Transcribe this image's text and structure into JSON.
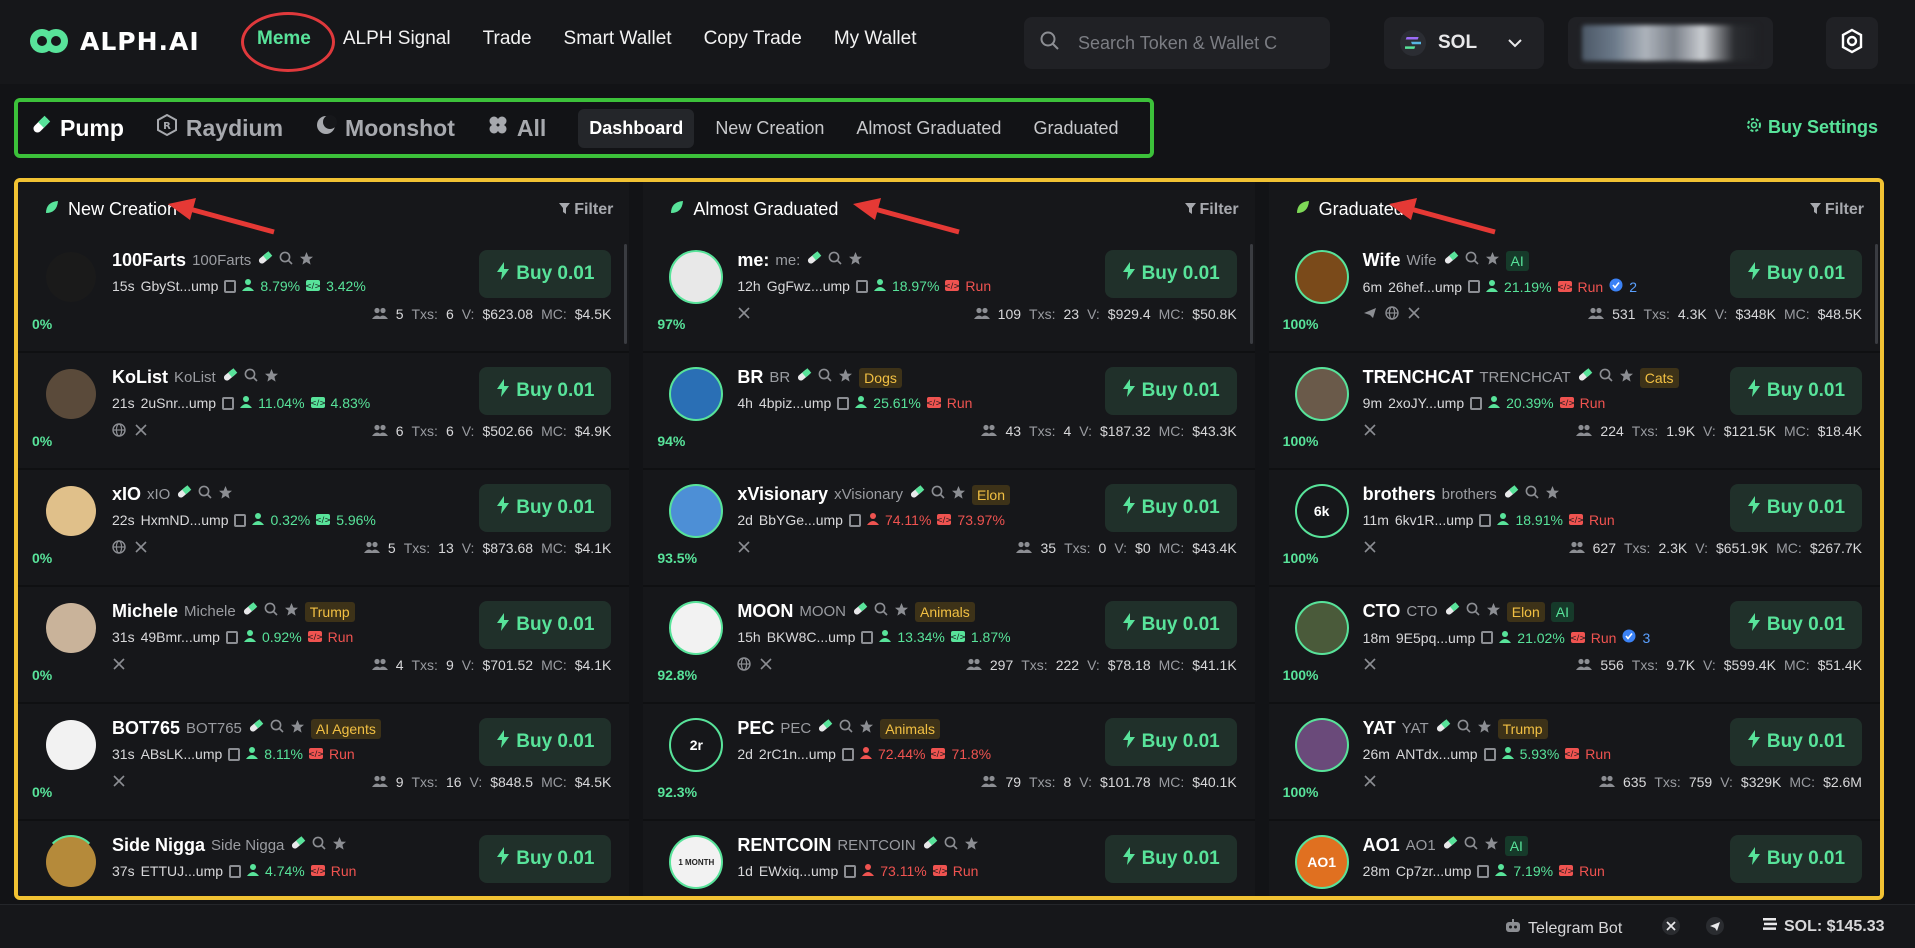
{
  "brand": {
    "name": "ALPH.AI"
  },
  "nav": [
    "Meme",
    "ALPH Signal",
    "Trade",
    "Smart Wallet",
    "Copy Trade",
    "My Wallet"
  ],
  "search": {
    "placeholder": "Search Token & Wallet C"
  },
  "chain": {
    "label": "SOL"
  },
  "platforms": [
    "Pump",
    "Raydium",
    "Moonshot",
    "All"
  ],
  "views": [
    "Dashboard",
    "New Creation",
    "Almost Graduated",
    "Graduated"
  ],
  "buy_settings": "Buy Settings",
  "filter_label": "Filter",
  "buy_label": "Buy 0.01",
  "columns": [
    {
      "title": "New Creation",
      "rows": [
        {
          "name": "100Farts",
          "sym": "100Farts",
          "tag": "",
          "time": "15s",
          "addr": "GbySt...ump",
          "p1": "8.79%",
          "p1c": "green",
          "p2": "3.42%",
          "p2c": "green",
          "run": false,
          "pct": "0%",
          "holders": "5",
          "txs": "6",
          "vol": "$623.08",
          "mc": "$4.5K",
          "social": [],
          "avcolor": "#1a1a1a",
          "ring": "none"
        },
        {
          "name": "KoList",
          "sym": "KoList",
          "tag": "",
          "time": "21s",
          "addr": "2uSnr...ump",
          "p1": "11.04%",
          "p1c": "green",
          "p2": "4.83%",
          "p2c": "green",
          "run": false,
          "pct": "0%",
          "holders": "6",
          "txs": "6",
          "vol": "$502.66",
          "mc": "$4.9K",
          "social": [
            "web",
            "x"
          ],
          "avcolor": "#5a4a3a",
          "ring": "none"
        },
        {
          "name": "xIO",
          "sym": "xIO",
          "tag": "",
          "time": "22s",
          "addr": "HxmND...ump",
          "p1": "0.32%",
          "p1c": "green",
          "p2": "5.96%",
          "p2c": "green",
          "run": false,
          "pct": "0%",
          "holders": "5",
          "txs": "13",
          "vol": "$873.68",
          "mc": "$4.1K",
          "social": [
            "web",
            "x"
          ],
          "avcolor": "#e0c08a",
          "ring": "none"
        },
        {
          "name": "Michele",
          "sym": "Michele",
          "tag": "Trump",
          "time": "31s",
          "addr": "49Bmr...ump",
          "p1": "0.92%",
          "p1c": "green",
          "p2": "Run",
          "p2c": "red",
          "run": true,
          "pct": "0%",
          "holders": "4",
          "txs": "9",
          "vol": "$701.52",
          "mc": "$4.1K",
          "social": [
            "x"
          ],
          "avcolor": "#c9b39a",
          "ring": "none"
        },
        {
          "name": "BOT765",
          "sym": "BOT765",
          "tag": "AI Agents",
          "time": "31s",
          "addr": "ABsLK...ump",
          "p1": "8.11%",
          "p1c": "green",
          "p2": "Run",
          "p2c": "red",
          "run": true,
          "pct": "0%",
          "holders": "9",
          "txs": "16",
          "vol": "$848.5",
          "mc": "$4.5K",
          "social": [
            "x"
          ],
          "avcolor": "#f2f2f2",
          "ring": "none"
        },
        {
          "name": "Side Nigga",
          "sym": "Side Nigga",
          "tag": "",
          "time": "37s",
          "addr": "ETTUJ...ump",
          "p1": "4.74%",
          "p1c": "green",
          "p2": "Run",
          "p2c": "red",
          "run": true,
          "pct": "",
          "holders": "",
          "txs": "",
          "vol": "",
          "mc": "",
          "social": [],
          "avcolor": "#b58a3a",
          "ring": "part"
        }
      ]
    },
    {
      "title": "Almost Graduated",
      "rows": [
        {
          "name": "me:",
          "sym": "me:",
          "tag": "",
          "time": "12h",
          "addr": "GgFwz...ump",
          "p1": "18.97%",
          "p1c": "green",
          "p2": "Run",
          "p2c": "red",
          "run": true,
          "pct": "97%",
          "holders": "109",
          "txs": "23",
          "vol": "$929.4",
          "mc": "$50.8K",
          "social": [
            "x"
          ],
          "avcolor": "#e8e8e8",
          "ring": "full"
        },
        {
          "name": "BR",
          "sym": "BR",
          "tag": "Dogs",
          "time": "4h",
          "addr": "4bpiz...ump",
          "p1": "25.61%",
          "p1c": "green",
          "p2": "Run",
          "p2c": "red",
          "run": true,
          "pct": "94%",
          "holders": "43",
          "txs": "4",
          "vol": "$187.32",
          "mc": "$43.3K",
          "social": [],
          "avcolor": "#2a6fb5",
          "ring": "full"
        },
        {
          "name": "xVisionary",
          "sym": "xVisionary",
          "tag": "Elon",
          "time": "2d",
          "addr": "BbYGe...ump",
          "p1": "74.11%",
          "p1c": "red",
          "p2": "73.97%",
          "p2c": "red",
          "run": false,
          "pct": "93.5%",
          "holders": "35",
          "txs": "0",
          "vol": "$0",
          "mc": "$43.4K",
          "social": [
            "x"
          ],
          "avcolor": "#4d8fd6",
          "ring": "full"
        },
        {
          "name": "MOON",
          "sym": "MOON",
          "tag": "Animals",
          "time": "15h",
          "addr": "BKW8C...ump",
          "p1": "13.34%",
          "p1c": "green",
          "p2": "1.87%",
          "p2c": "green",
          "run": false,
          "pct": "92.8%",
          "holders": "297",
          "txs": "222",
          "vol": "$78.18",
          "mc": "$41.1K",
          "social": [
            "web",
            "x"
          ],
          "avcolor": "#f2f2f2",
          "ring": "full"
        },
        {
          "name": "PEC",
          "sym": "PEC",
          "tag": "Animals",
          "time": "2d",
          "addr": "2rC1n...ump",
          "p1": "72.44%",
          "p1c": "red",
          "p2": "71.8%",
          "p2c": "red",
          "run": false,
          "pct": "92.3%",
          "holders": "79",
          "txs": "8",
          "vol": "$101.78",
          "mc": "$40.1K",
          "social": [],
          "avcolor": "#16171a",
          "ring": "full",
          "avtext": "2r"
        },
        {
          "name": "RENTCOIN",
          "sym": "RENTCOIN",
          "tag": "",
          "time": "1d",
          "addr": "EWxiq...ump",
          "p1": "73.11%",
          "p1c": "red",
          "p2": "Run",
          "p2c": "red",
          "run": true,
          "pct": "",
          "holders": "",
          "txs": "",
          "vol": "",
          "mc": "",
          "social": [],
          "avcolor": "#f2f2f2",
          "ring": "full",
          "avtext": "1 MONTH"
        }
      ]
    },
    {
      "title": "Graduated",
      "rows": [
        {
          "name": "Wife",
          "sym": "Wife",
          "tag": "AI",
          "time": "6m",
          "addr": "26hef...ump",
          "p1": "21.19%",
          "p1c": "green",
          "p2": "Run",
          "p2c": "red",
          "run": true,
          "extra": "2",
          "pct": "100%",
          "holders": "531",
          "txs": "4.3K",
          "vol": "$348K",
          "mc": "$48.5K",
          "social": [
            "tg",
            "web",
            "x"
          ],
          "avcolor": "#7a4a1a",
          "ring": "full"
        },
        {
          "name": "TRENCHCAT",
          "sym": "TRENCHCAT",
          "tag": "Cats",
          "time": "9m",
          "addr": "2xoJY...ump",
          "p1": "20.39%",
          "p1c": "green",
          "p2": "Run",
          "p2c": "red",
          "run": true,
          "pct": "100%",
          "holders": "224",
          "txs": "1.9K",
          "vol": "$121.5K",
          "mc": "$18.4K",
          "social": [
            "x"
          ],
          "avcolor": "#6a5a4a",
          "ring": "full"
        },
        {
          "name": "brothers",
          "sym": "brothers",
          "tag": "",
          "time": "11m",
          "addr": "6kv1R...ump",
          "p1": "18.91%",
          "p1c": "green",
          "p2": "Run",
          "p2c": "red",
          "run": true,
          "pct": "100%",
          "holders": "627",
          "txs": "2.3K",
          "vol": "$651.9K",
          "mc": "$267.7K",
          "social": [
            "x"
          ],
          "avcolor": "#16171a",
          "ring": "full",
          "avtext": "6k"
        },
        {
          "name": "CTO",
          "sym": "CTO",
          "tag": "Elon",
          "tag2": "AI",
          "time": "18m",
          "addr": "9E5pq...ump",
          "p1": "21.02%",
          "p1c": "green",
          "p2": "Run",
          "p2c": "red",
          "run": true,
          "extra": "3",
          "pct": "100%",
          "holders": "556",
          "txs": "9.7K",
          "vol": "$599.4K",
          "mc": "$51.4K",
          "social": [
            "x"
          ],
          "avcolor": "#4a5a3a",
          "ring": "full"
        },
        {
          "name": "YAT",
          "sym": "YAT",
          "tag": "Trump",
          "time": "26m",
          "addr": "ANTdx...ump",
          "p1": "5.93%",
          "p1c": "green",
          "p2": "Run",
          "p2c": "red",
          "run": true,
          "pct": "100%",
          "holders": "635",
          "txs": "759",
          "vol": "$329K",
          "mc": "$2.6M",
          "social": [
            "x"
          ],
          "avcolor": "#6a4a7a",
          "ring": "full"
        },
        {
          "name": "AO1",
          "sym": "AO1",
          "tag": "AI",
          "time": "28m",
          "addr": "Cp7zr...ump",
          "p1": "7.19%",
          "p1c": "green",
          "p2": "Run",
          "p2c": "red",
          "run": true,
          "pct": "",
          "holders": "",
          "txs": "",
          "vol": "",
          "mc": "",
          "social": [],
          "avcolor": "#e07020",
          "ring": "full",
          "avtext": "AO1"
        }
      ]
    }
  ],
  "labels": {
    "txs": "Txs:",
    "vol": "V:",
    "mc": "MC:"
  },
  "statusbar": {
    "telegram": "Telegram Bot",
    "sol_price": "SOL: $145.33"
  },
  "colors": {
    "accent": "#58e39a",
    "danger": "#ef5350",
    "highlight_nav": "#e0393c",
    "highlight_bar": "#3cc13a",
    "highlight_board": "#f1c233"
  }
}
